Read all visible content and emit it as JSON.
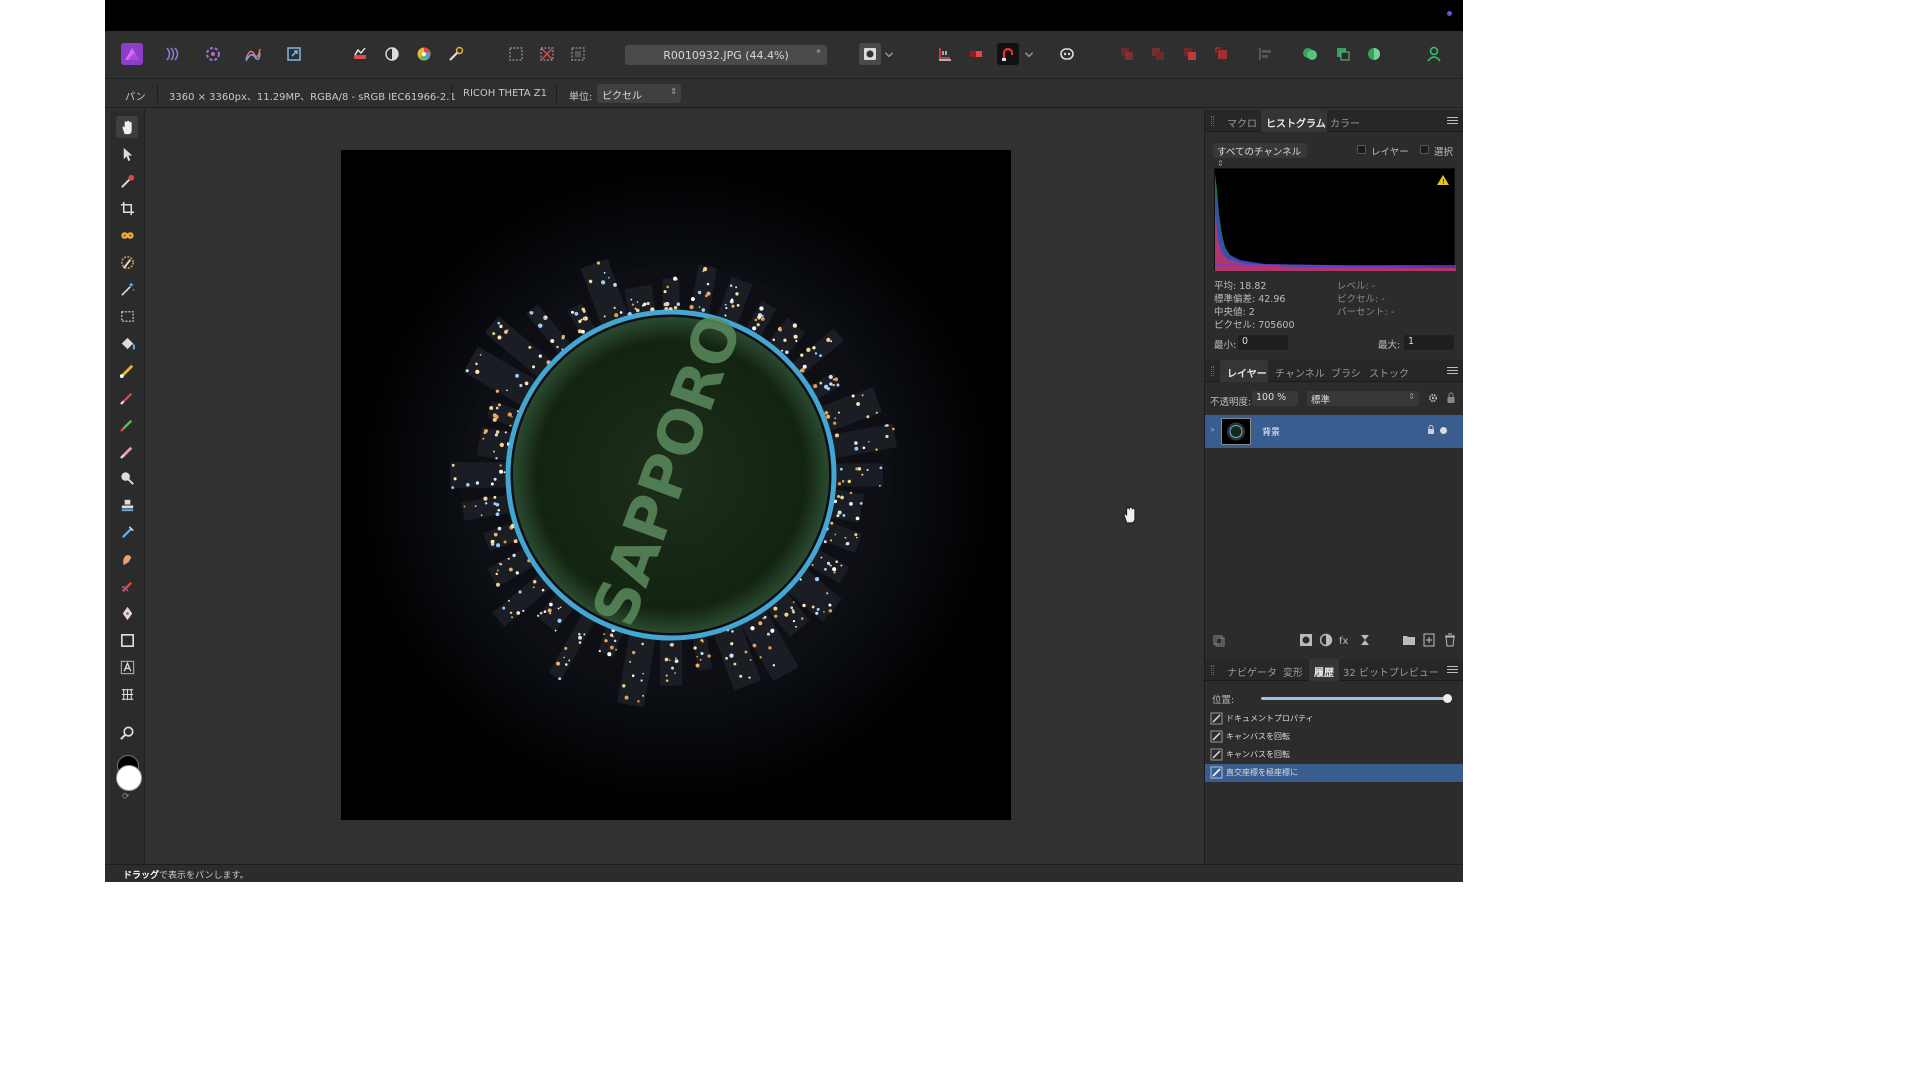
{
  "app": {
    "name": "Affinity Photo"
  },
  "toolbar": {
    "document_title": "R0010932.JPG (44.4%)",
    "modified_mark": "*"
  },
  "context": {
    "tool_name": "パン",
    "image_info": "3360 × 3360px、11.29MP、RGBA/8 - sRGB IEC61966-2.1",
    "camera": "RICOH THETA Z1",
    "units_label": "単位:",
    "units_value": "ピクセル"
  },
  "top_panel": {
    "tabs": [
      "マクロ",
      "ヒストグラム",
      "カラー"
    ],
    "active_tab": "ヒストグラム",
    "channel_select": "すべてのチャンネル",
    "checkbox_layer": "レイヤー",
    "checkbox_selection": "選択",
    "stats": {
      "mean": "平均: 18.82",
      "std": "標準偏差: 42.96",
      "median": "中央値: 2",
      "pixels": "ピクセル: 705600",
      "level": "レベル: -",
      "pixel": "ピクセル: -",
      "percent": "パーセント: -"
    },
    "min_label": "最小:",
    "min_value": "0",
    "max_label": "最大:",
    "max_value": "1"
  },
  "layers_panel": {
    "tabs": [
      "レイヤー",
      "チャンネル",
      "ブラシ",
      "ストック"
    ],
    "active_tab": "レイヤー",
    "opacity_label": "不透明度:",
    "opacity_value": "100 %",
    "blend_mode": "標準",
    "layers": [
      {
        "name": "背景"
      }
    ]
  },
  "history_panel": {
    "tabs": [
      "ナビゲータ",
      "変形",
      "履歴",
      "32 ビットプレビュー"
    ],
    "active_tab": "履歴",
    "position_label": "位置:",
    "position_value": 1.0,
    "items": [
      "ドキュメントプロパティ",
      "キャンバスを回転",
      "キャンバスを回転",
      "直交座標を極座標に"
    ],
    "selected_index": 3
  },
  "status": {
    "bold": "ドラッグ",
    "text": "で表示をパンします。"
  },
  "canvas": {
    "image_text": "SAPPORO"
  }
}
